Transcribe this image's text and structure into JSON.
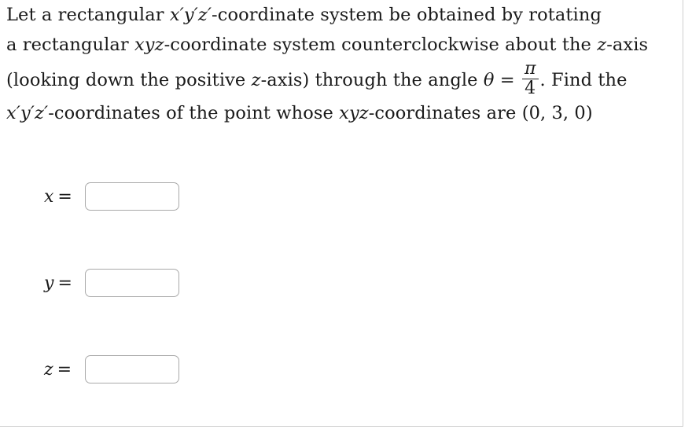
{
  "problem": {
    "lines": [
      {
        "id": "line1",
        "parts": [
          {
            "t": "text",
            "v": "Let a rectangular "
          },
          {
            "t": "var",
            "v": "x′y′z′"
          },
          {
            "t": "text",
            "v": "-coordinate system be obtained by rotating"
          }
        ]
      },
      {
        "id": "line2",
        "parts": [
          {
            "t": "text",
            "v": "a rectangular "
          },
          {
            "t": "var",
            "v": "xyz"
          },
          {
            "t": "text",
            "v": "-coordinate system counterclockwise about the "
          },
          {
            "t": "var",
            "v": "z"
          },
          {
            "t": "text",
            "v": "-axis"
          }
        ]
      },
      {
        "id": "line3",
        "parts": [
          {
            "t": "text",
            "v": "(looking down the positive "
          },
          {
            "t": "var",
            "v": "z"
          },
          {
            "t": "text",
            "v": "-axis) through the angle "
          },
          {
            "t": "var",
            "v": "θ"
          },
          {
            "t": "text",
            "v": " = "
          },
          {
            "t": "frac",
            "num": "π",
            "den": "4"
          },
          {
            "t": "text",
            "v": ". Find the"
          }
        ]
      },
      {
        "id": "line4",
        "parts": [
          {
            "t": "var",
            "v": "x′y′z′"
          },
          {
            "t": "text",
            "v": "-coordinates of the point whose "
          },
          {
            "t": "var",
            "v": "xyz"
          },
          {
            "t": "text",
            "v": "-coordinates are "
          },
          {
            "t": "text",
            "v": "(0, 3, 0)."
          }
        ]
      }
    ],
    "line1_text": "Let a rectangular x′y′z′-coordinate system be obtained by rotating",
    "line2_text": "a rectangular xyz-coordinate system counterclockwise about the z-axis",
    "line3_text": "(looking down the positive z-axis) through the angle θ = π/4. Find the",
    "line4_text": "x′y′z′-coordinates of the point whose xyz-coordinates are (0, 3, 0).",
    "angle": {
      "symbol": "θ",
      "equals": "=",
      "numerator": "π",
      "denominator": "4"
    },
    "given_point": "(0, 3, 0)"
  },
  "answers": {
    "rows": [
      {
        "label_var": "x",
        "label_eq": "=",
        "value": "",
        "placeholder": ""
      },
      {
        "label_var": "y",
        "label_eq": "=",
        "value": "",
        "placeholder": ""
      },
      {
        "label_var": "z",
        "label_eq": "=",
        "value": "",
        "placeholder": ""
      }
    ]
  },
  "style": {
    "text_color": "#1a1a1a",
    "input_border_color": "#a9a9a9",
    "frame_line_color": "#cfcfcf",
    "background": "#ffffff"
  }
}
